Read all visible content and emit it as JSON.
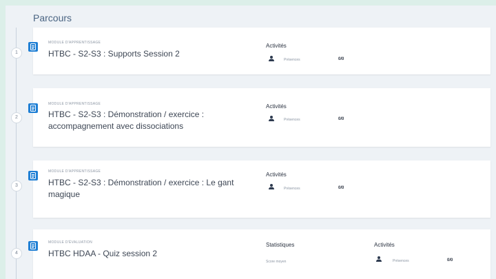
{
  "heading": "Parcours",
  "cards": [
    {
      "number": "1",
      "kicker": "Module d'apprentissage",
      "title": "HTBC - S2-S3 : Supports Session 2",
      "activities_label": "Activités",
      "presence_label": "Présences",
      "presence_count": "0/0"
    },
    {
      "number": "2",
      "kicker": "Module d'apprentissage",
      "title": "HTBC - S2-S3 : Démonstration / exercice : accompagnement avec dissociations",
      "activities_label": "Activités",
      "presence_label": "Présences",
      "presence_count": "0/0"
    },
    {
      "number": "3",
      "kicker": "Module d'apprentissage",
      "title": "HTBC - S2-S3 : Démonstration / exercice : Le gant magique",
      "activities_label": "Activités",
      "presence_label": "Présences",
      "presence_count": "0/0"
    },
    {
      "number": "4",
      "kicker": "Module d'évaluation",
      "title": "HTBC HDAA - Quiz session 2",
      "stats_label": "Statistiques",
      "score_label": "Score moyen",
      "activities_label": "Activités",
      "presence_label": "Présences",
      "presence_count": "0/0"
    }
  ],
  "colors": {
    "accent": "#1f7fd4",
    "heading": "#4a6482",
    "background": "#eef2f6"
  },
  "icons": {
    "module": "document-list-icon",
    "presence": "person-icon"
  }
}
